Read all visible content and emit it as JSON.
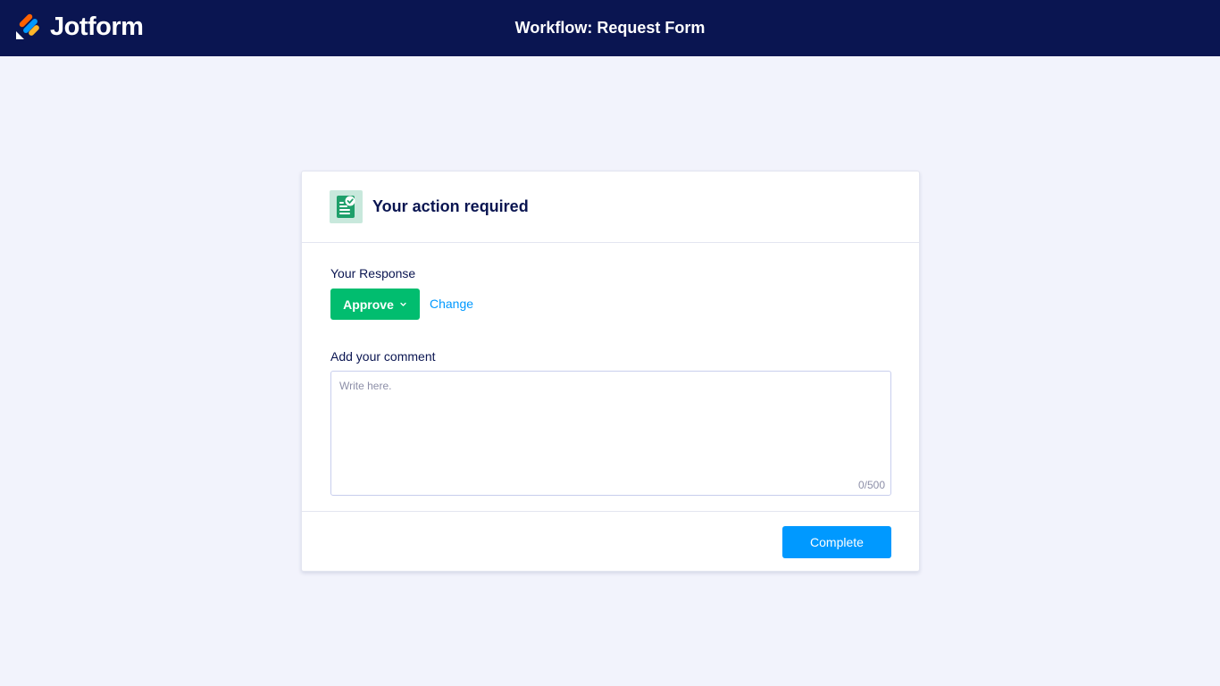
{
  "header": {
    "brand": "Jotform",
    "title": "Workflow: Request Form"
  },
  "card": {
    "title": "Your action required",
    "icon": "approval-document-icon",
    "response": {
      "label": "Your Response",
      "selected": "Approve",
      "change_label": "Change"
    },
    "comment": {
      "label": "Add your comment",
      "placeholder": "Write here.",
      "value": "",
      "counter": "0/500"
    },
    "complete_label": "Complete"
  },
  "colors": {
    "topbar": "#0a1551",
    "background": "#f2f3fc",
    "approve": "#01bd6f",
    "primary": "#0099ff"
  }
}
